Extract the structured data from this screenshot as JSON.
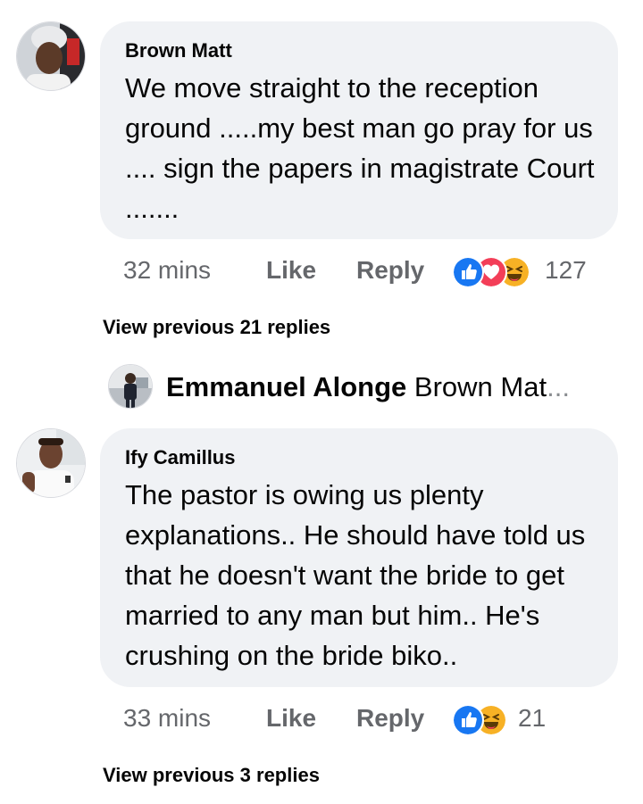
{
  "comments": [
    {
      "author": "Brown Matt",
      "text": "We move straight to the reception ground .....my best man go pray for us .... sign the papers in magistrate Court .......",
      "time": "32 mins",
      "like_label": "Like",
      "reply_label": "Reply",
      "reaction_count": "127",
      "reactions": [
        "like",
        "love",
        "haha"
      ],
      "view_previous": "View previous 21 replies",
      "nested_reply": {
        "author": "Emmanuel Alonge",
        "preview": "Brown Mat",
        "ellipsis": "..."
      }
    },
    {
      "author": "Ify Camillus",
      "text": "The pastor is owing us plenty explanations.. He should have told us that he doesn't want the bride to get married to any man but him.. He's crushing on the bride biko..",
      "time": "33 mins",
      "like_label": "Like",
      "reply_label": "Reply",
      "reaction_count": "21",
      "reactions": [
        "like",
        "haha"
      ],
      "view_previous": "View previous 3 replies"
    }
  ],
  "colors": {
    "bubble": "#f0f2f5",
    "meta_text": "#65676b",
    "like_blue": "#1877f2",
    "love_red": "#f33e58",
    "haha_yellow": "#f7b125"
  }
}
